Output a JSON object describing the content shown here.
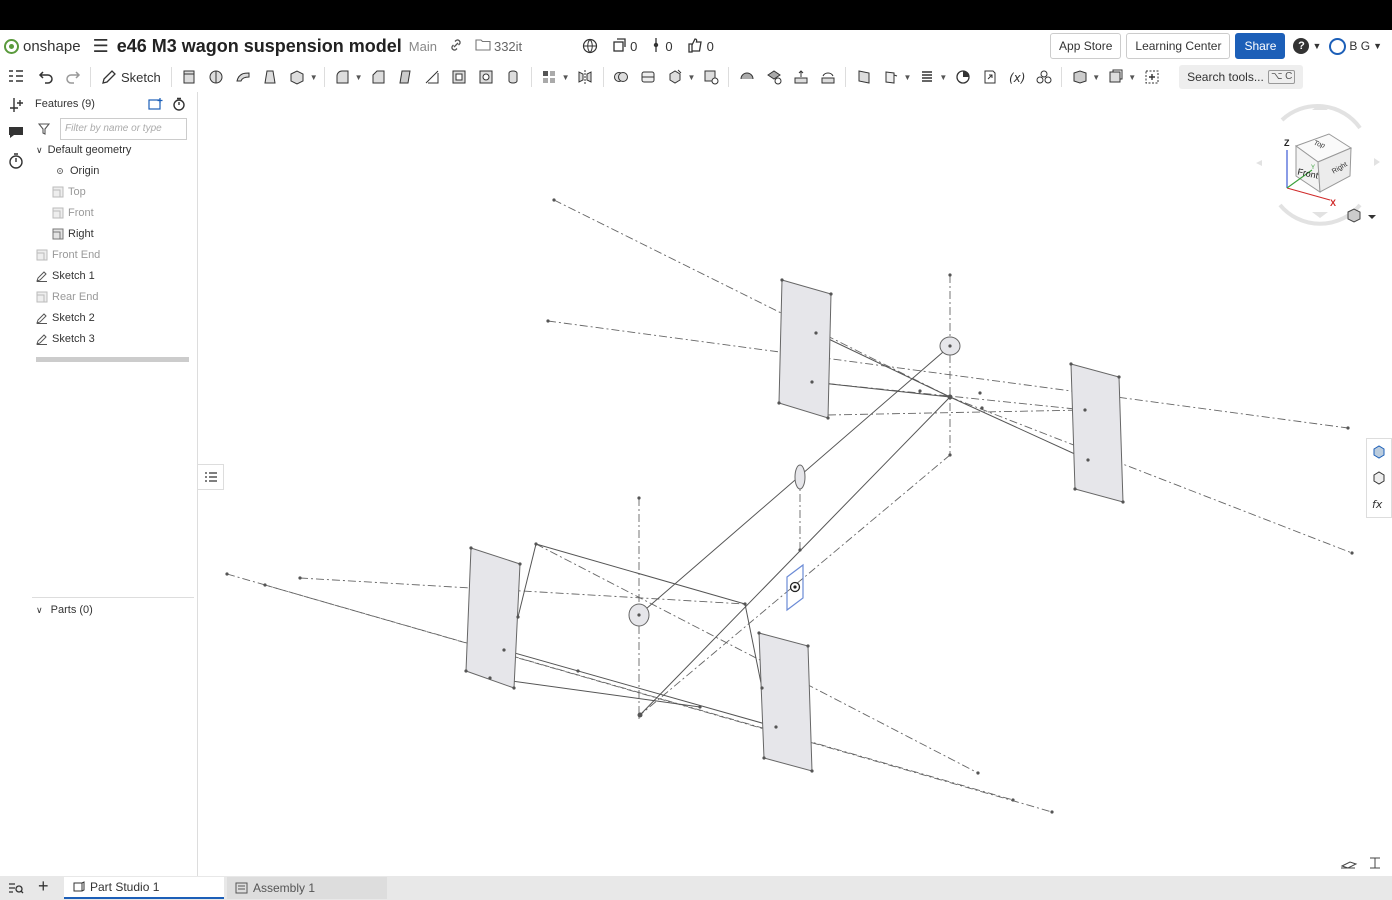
{
  "app": {
    "logo_text": "onshape"
  },
  "document": {
    "title": "e46 M3 wagon suspension model",
    "branch": "Main",
    "workspace": "332it"
  },
  "counters": {
    "versions": "0",
    "branches": "0",
    "likes": "0"
  },
  "header_buttons": {
    "app_store": "App Store",
    "learning_center": "Learning Center",
    "share": "Share",
    "help": "?",
    "user_initials": "B G"
  },
  "toolbar": {
    "sketch_label": "Sketch",
    "search_tools": "Search tools...",
    "search_shortcut": "⌥ C"
  },
  "features": {
    "heading": "Features (9)",
    "filter_placeholder": "Filter by name or type",
    "default_geometry": "Default geometry",
    "items": [
      {
        "label": "Origin"
      },
      {
        "label": "Top"
      },
      {
        "label": "Front"
      },
      {
        "label": "Right"
      },
      {
        "label": "Front End"
      },
      {
        "label": "Sketch 1"
      },
      {
        "label": "Rear End"
      },
      {
        "label": "Sketch 2"
      },
      {
        "label": "Sketch 3"
      }
    ]
  },
  "parts": {
    "heading": "Parts (0)"
  },
  "view_cube": {
    "top": "Top",
    "front": "Front",
    "right": "Right",
    "axis_z": "Z",
    "axis_x": "X",
    "axis_y": "Y"
  },
  "tabs": [
    {
      "label": "Part Studio 1"
    },
    {
      "label": "Assembly 1"
    }
  ],
  "colors": {
    "accent": "#1c5fb8",
    "logo": "#5a9a3c",
    "plane_fill": "#e6e6ea",
    "sketch_line": "#555555"
  }
}
